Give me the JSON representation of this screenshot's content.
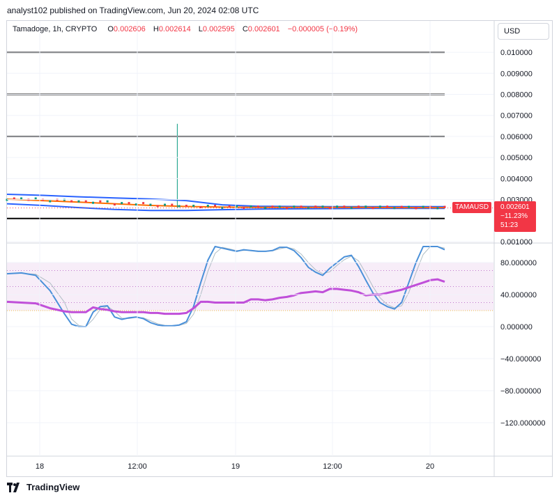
{
  "header": {
    "publisher_line": "analyst102 published on TradingView.com, Jun 20, 2024 02:08 UTC"
  },
  "legend": {
    "symbol": "Tamadoge, 1h, CRYPTO",
    "o_label": "O",
    "o_value": "0.002606",
    "h_label": "H",
    "h_value": "0.002614",
    "l_label": "L",
    "l_value": "0.002595",
    "c_label": "C",
    "c_value": "0.002601",
    "change": "−0.000005 (−0.19%)"
  },
  "currency": "USD",
  "price_tag": {
    "symbol": "TAMAUSD",
    "price": "0.002601",
    "change_pct": "−11.23%",
    "countdown": "51:23"
  },
  "footer": {
    "brand": "TradingView"
  },
  "colors": {
    "up": "#089981",
    "down": "#f23645",
    "bollinger": "#2962ff",
    "ema": "#ff6d00",
    "stoch_k": "#4a90d9",
    "rsi": "#c04fd9",
    "level_line": "#000000"
  },
  "chart_data": [
    {
      "type": "line",
      "name": "price-pane",
      "y_axis_labels": [
        "0.010000",
        "0.009000",
        "0.008000",
        "0.007000",
        "0.006000",
        "0.005000",
        "0.004000",
        "0.003000",
        "0.001000"
      ],
      "ylim": [
        0.001,
        0.0103
      ],
      "x_labels": [
        "18",
        "12:00",
        "19",
        "12:00",
        "20"
      ],
      "x_range": [
        0,
        61
      ],
      "x_ticks": [
        5,
        20,
        35,
        50,
        65
      ],
      "horizontal_levels": [
        0.01,
        0.008,
        0.006,
        0.0021
      ],
      "spike": {
        "x": 25,
        "high": 0.0066,
        "low": 0.0026
      },
      "bollinger_upper": {
        "x": [
          0,
          5,
          10,
          15,
          20,
          25,
          30,
          35,
          40,
          45,
          50,
          55,
          61
        ],
        "y": [
          0.00325,
          0.0032,
          0.00313,
          0.00308,
          0.00303,
          0.00295,
          0.00275,
          0.00268,
          0.00267,
          0.00266,
          0.00266,
          0.00266,
          0.00266
        ]
      },
      "bollinger_lower": {
        "x": [
          0,
          5,
          10,
          15,
          20,
          25,
          30,
          35,
          40,
          45,
          50,
          55,
          61
        ],
        "y": [
          0.0028,
          0.00272,
          0.00262,
          0.00253,
          0.00248,
          0.00248,
          0.00252,
          0.00255,
          0.00256,
          0.00257,
          0.00258,
          0.00258,
          0.00258
        ]
      },
      "ema": {
        "x": [
          0,
          5,
          10,
          15,
          20,
          25,
          30,
          35,
          40,
          45,
          50,
          55,
          61
        ],
        "y": [
          0.00302,
          0.00295,
          0.00288,
          0.0028,
          0.00272,
          0.00267,
          0.00264,
          0.00263,
          0.00263,
          0.00263,
          0.00263,
          0.00262,
          0.00262
        ]
      },
      "last_price": 0.002601
    },
    {
      "type": "line",
      "name": "oscillator-pane",
      "y_axis_labels": [
        "80.000000",
        "40.000000",
        "0.000000",
        "−40.000000",
        "−80.000000",
        "−120.000000"
      ],
      "ylim": [
        -150,
        100
      ],
      "band": [
        20,
        80
      ],
      "dotted_levels": [
        70,
        50,
        30
      ],
      "series": [
        {
          "name": "stochastic",
          "x": [
            0,
            2,
            4,
            6,
            8,
            9,
            10,
            11,
            12,
            13,
            14,
            15,
            16,
            17,
            18,
            19,
            20,
            21,
            22,
            23,
            24,
            25,
            26,
            27,
            28,
            29,
            30,
            31,
            32,
            33,
            34,
            35,
            36,
            37,
            38,
            39,
            40,
            41,
            42,
            43,
            44,
            45,
            46,
            47,
            48,
            49,
            50,
            51,
            52,
            53,
            54,
            55,
            56,
            57,
            58,
            59,
            60,
            61
          ],
          "y": [
            66,
            67,
            64,
            45,
            16,
            3,
            0,
            0,
            18,
            25,
            26,
            12,
            9,
            11,
            12,
            10,
            5,
            2,
            1,
            1,
            2,
            6,
            25,
            55,
            83,
            100,
            98,
            96,
            94,
            96,
            95,
            94,
            94,
            95,
            99,
            99,
            95,
            86,
            74,
            68,
            64,
            73,
            80,
            87,
            89,
            75,
            58,
            42,
            30,
            25,
            22,
            30,
            55,
            80,
            100,
            100,
            100,
            96
          ]
        },
        {
          "name": "rsi",
          "x": [
            0,
            2,
            4,
            6,
            8,
            9,
            10,
            11,
            12,
            13,
            14,
            15,
            16,
            17,
            18,
            19,
            20,
            21,
            22,
            23,
            24,
            25,
            26,
            27,
            28,
            29,
            30,
            31,
            32,
            33,
            34,
            35,
            36,
            37,
            38,
            39,
            40,
            41,
            42,
            43,
            44,
            45,
            46,
            47,
            48,
            49,
            50,
            51,
            52,
            53,
            54,
            55,
            56,
            57,
            58,
            59,
            60,
            61
          ],
          "y": [
            31,
            30,
            29,
            23,
            19,
            18,
            18,
            18,
            24,
            22,
            21,
            19,
            18,
            18,
            18,
            18,
            17,
            17,
            16,
            16,
            16,
            17,
            23,
            31,
            31,
            30,
            30,
            30,
            30,
            30,
            34,
            34,
            33,
            34,
            36,
            37,
            39,
            42,
            43,
            44,
            43,
            47,
            47,
            46,
            45,
            43,
            39,
            40,
            40,
            42,
            44,
            46,
            49,
            52,
            55,
            58,
            59,
            56
          ]
        }
      ]
    }
  ]
}
